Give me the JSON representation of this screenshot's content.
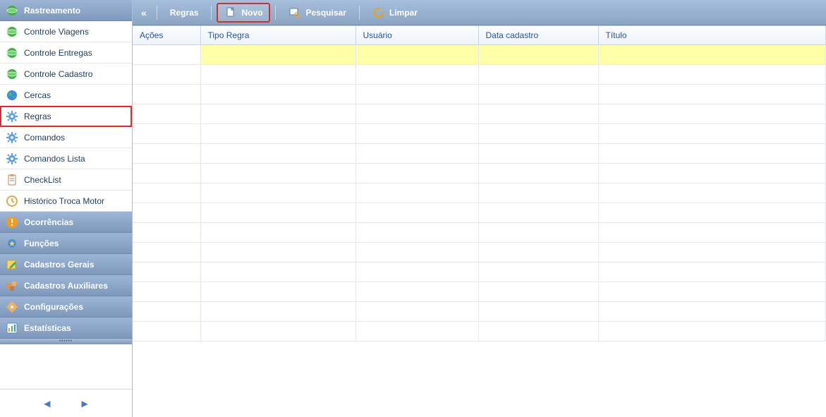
{
  "sidebar": {
    "sections": [
      {
        "label": "Rastreamento",
        "header": true,
        "icon": "globe-green"
      },
      {
        "label": "Controle Viagens",
        "icon": "globe-green"
      },
      {
        "label": "Controle Entregas",
        "icon": "globe-green"
      },
      {
        "label": "Controle Cadastro",
        "icon": "globe-green"
      },
      {
        "label": "Cercas",
        "icon": "world"
      },
      {
        "label": "Regras",
        "icon": "gear-blue",
        "highlighted": true
      },
      {
        "label": "Comandos",
        "icon": "gear-blue"
      },
      {
        "label": "Comandos Lista",
        "icon": "gear-blue"
      },
      {
        "label": "CheckList",
        "icon": "clipboard"
      },
      {
        "label": "Histórico Troca Motor",
        "icon": "history"
      },
      {
        "label": "Ocorrências",
        "header": true,
        "icon": "alert"
      },
      {
        "label": "Funções",
        "header": true,
        "icon": "gear-star"
      },
      {
        "label": "Cadastros Gerais",
        "header": true,
        "icon": "edit"
      },
      {
        "label": "Cadastros Auxiliares",
        "header": true,
        "icon": "boxes"
      },
      {
        "label": "Configurações",
        "header": true,
        "icon": "settings"
      },
      {
        "label": "Estatísticas",
        "header": true,
        "icon": "chart"
      }
    ],
    "pager": {
      "active_index": 0,
      "count": 4
    }
  },
  "toolbar": {
    "title": "Regras",
    "buttons": {
      "novo": "Novo",
      "pesquisar": "Pesquisar",
      "limpar": "Limpar"
    }
  },
  "table": {
    "columns": [
      "Ações",
      "Tipo Regra",
      "Usuário",
      "Data cadastro",
      "Título"
    ],
    "filter_row": [
      "",
      "",
      "",
      "",
      ""
    ],
    "rows": [
      [
        "",
        "",
        "",
        "",
        ""
      ],
      [
        "",
        "",
        "",
        "",
        ""
      ],
      [
        "",
        "",
        "",
        "",
        ""
      ],
      [
        "",
        "",
        "",
        "",
        ""
      ],
      [
        "",
        "",
        "",
        "",
        ""
      ],
      [
        "",
        "",
        "",
        "",
        ""
      ],
      [
        "",
        "",
        "",
        "",
        ""
      ],
      [
        "",
        "",
        "",
        "",
        ""
      ],
      [
        "",
        "",
        "",
        "",
        ""
      ],
      [
        "",
        "",
        "",
        "",
        ""
      ],
      [
        "",
        "",
        "",
        "",
        ""
      ],
      [
        "",
        "",
        "",
        "",
        ""
      ],
      [
        "",
        "",
        "",
        "",
        ""
      ],
      [
        "",
        "",
        "",
        "",
        ""
      ]
    ]
  }
}
